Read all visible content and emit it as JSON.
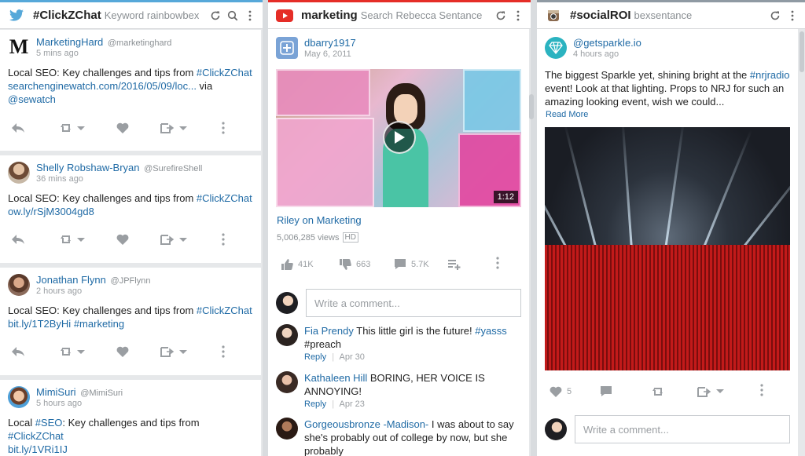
{
  "columns": [
    {
      "title": "#ClickZChat",
      "subtitle": "Keyword rainbowbex",
      "icon": "twitter-icon"
    },
    {
      "title": "marketing",
      "subtitle": "Search Rebecca Sentance",
      "icon": "youtube-icon"
    },
    {
      "title": "#socialROI",
      "subtitle": "bexsentance",
      "icon": "instagram-icon"
    }
  ],
  "twitter_posts": [
    {
      "author": "MarketingHard",
      "handle": "@marketinghard",
      "time": "5 mins ago",
      "text_prefix": "Local SEO: Key challenges and tips from ",
      "tag": "#ClickZChat",
      "link": "searchenginewatch.com/2016/05/09/loc...",
      "text_via": " via ",
      "mention": "@sewatch"
    },
    {
      "author": "Shelly Robshaw-Bryan",
      "handle": "@SurefireShell",
      "time": "36 mins ago",
      "text_prefix": "Local SEO: Key challenges and tips from ",
      "tag": "#ClickZChat",
      "link": "ow.ly/rSjM3004gd8"
    },
    {
      "author": "Jonathan Flynn",
      "handle": "@JPFlynn",
      "time": "2 hours ago",
      "text_prefix": "Local SEO: Key challenges and tips from ",
      "tag": "#ClickZChat",
      "link": "bit.ly/1T2ByHi",
      "tag2": "#marketing"
    },
    {
      "author": "MimiSuri",
      "handle": "@MimiSuri",
      "time": "5 hours ago",
      "text_a": "Local ",
      "tag_a": "#SEO",
      "text_b": ": Key challenges and tips from ",
      "tag": "#ClickZChat",
      "link": "bit.ly/1VRi1IJ"
    }
  ],
  "youtube_post": {
    "author": "dbarry1917",
    "date": "May 6, 2011",
    "duration": "1:12",
    "video_title": "Riley on Marketing",
    "views": "5,006,285 views",
    "hd": "HD",
    "likes": "41K",
    "dislikes": "663",
    "comments": "5.7K",
    "comment_placeholder": "Write a comment...",
    "comment_list": [
      {
        "author": "Fia Prendy",
        "text": " This little girl is the future! ",
        "tag": "#yasss",
        "text2": "#preach",
        "reply": "Reply",
        "date": "Apr 30"
      },
      {
        "author": "Kathaleen Hill",
        "text": " BORING, HER VOICE IS ANNOYING!",
        "reply": "Reply",
        "date": "Apr 23"
      },
      {
        "author": "Gorgeousbronze -Madison-",
        "text": " I was about to say she's probably out of college by now, but she probably"
      }
    ]
  },
  "instagram_post": {
    "author": "@getsparkle.io",
    "time": "4 hours ago",
    "text_a": "The biggest Sparkle yet, shining bright at the ",
    "tag": "#nrjradio",
    "text_b": " event! Look at that lighting. Props to NRJ for such an amazing looking event, wish we could...",
    "read_more": "Read More",
    "likes": "5",
    "comment_placeholder": "Write a comment..."
  },
  "colors": {
    "link": "#1f6aa5",
    "twitter": "#56a8d9",
    "youtube": "#e52d27",
    "sparkle": "#2bb3c0"
  }
}
